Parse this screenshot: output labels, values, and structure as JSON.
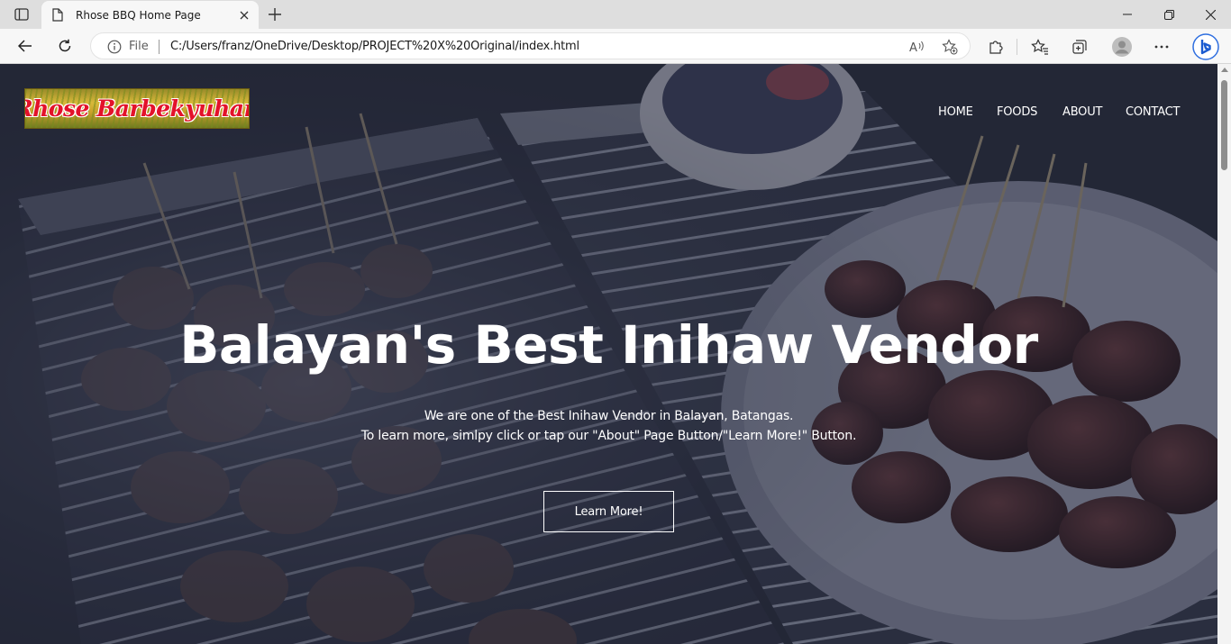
{
  "browser": {
    "tab_title": "Rhose BBQ Home Page",
    "omnibox_prefix": "File",
    "url": "C:/Users/franz/OneDrive/Desktop/PROJECT%20X%20Original/index.html",
    "icons": {
      "sidebar": "sidebar-icon",
      "favicon": "page-icon",
      "tab_close": "close-icon",
      "new_tab": "plus-icon",
      "back": "back-arrow-icon",
      "reload": "reload-icon",
      "info": "info-icon",
      "read_aloud": "read-aloud-icon",
      "favorite_add": "star-add-icon",
      "extensions": "puzzle-icon",
      "favorites": "favorites-icon",
      "collections": "collections-icon",
      "profile": "profile-icon",
      "menu": "more-icon",
      "bing": "bing-icon"
    }
  },
  "site": {
    "logo_text": "Rhose Barbekyuhan",
    "nav": [
      "HOME",
      "FOODS",
      "ABOUT",
      "CONTACT"
    ],
    "hero": {
      "title": "Balayan's Best Inihaw Vendor",
      "line1": "We are one of the Best Inihaw Vendor in Balayan, Batangas.",
      "line2": "To learn more, simlpy click or tap our \"About\" Page Button/\"Learn More!\" Button.",
      "button": "Learn More!"
    },
    "colors": {
      "overlay": "#1e2335",
      "logo_red": "#e3122a",
      "text": "#ffffff"
    }
  }
}
